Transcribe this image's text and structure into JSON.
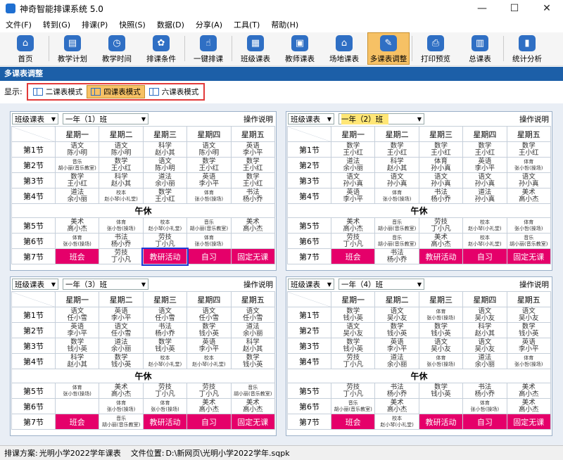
{
  "app": {
    "title": "神奇智能排课系统 5.0",
    "window_buttons": [
      "—",
      "☐",
      "✕"
    ]
  },
  "menu": [
    "文件(F)",
    "转到(G)",
    "排课(P)",
    "快照(S)",
    "数据(D)",
    "分享(A)",
    "工具(T)",
    "帮助(H)"
  ],
  "toolbar": [
    {
      "label": "首页",
      "icon": "home-icon",
      "glyph": "⌂"
    },
    {
      "label": "教学计划",
      "icon": "plan-icon",
      "glyph": "▤"
    },
    {
      "label": "教学时间",
      "icon": "clock-icon",
      "glyph": "◷"
    },
    {
      "label": "排课条件",
      "icon": "conditions-icon",
      "glyph": "✿"
    },
    {
      "label": "一键排课",
      "icon": "one-click-icon",
      "glyph": "☝"
    },
    {
      "label": "班级课表",
      "icon": "class-timetable-icon",
      "glyph": "▦"
    },
    {
      "label": "教师课表",
      "icon": "teacher-timetable-icon",
      "glyph": "▣"
    },
    {
      "label": "场地课表",
      "icon": "venue-timetable-icon",
      "glyph": "⌂"
    },
    {
      "label": "多课表调整",
      "icon": "multi-adjust-icon",
      "glyph": "✎",
      "active": true
    },
    {
      "label": "打印预览",
      "icon": "print-icon",
      "glyph": "⎙"
    },
    {
      "label": "总课表",
      "icon": "master-timetable-icon",
      "glyph": "▥"
    },
    {
      "label": "统计分析",
      "icon": "statistics-icon",
      "glyph": "▮"
    }
  ],
  "section_title": "多课表调整",
  "mode": {
    "label": "显示:",
    "options": [
      {
        "label": "二课表模式",
        "active": false
      },
      {
        "label": "四课表模式",
        "active": true
      },
      {
        "label": "六课表模式",
        "active": false
      }
    ]
  },
  "days": [
    "星期一",
    "星期二",
    "星期三",
    "星期四",
    "星期五"
  ],
  "periods": [
    "第1节",
    "第2节",
    "第3节",
    "第4节",
    "第5节",
    "第6节",
    "第7节"
  ],
  "lunch": "午休",
  "panels": [
    {
      "type": "班级课表",
      "class": "一年（1）班",
      "help": "操作说明",
      "highlight": false,
      "rows": [
        [
          [
            "语文",
            "陈小明"
          ],
          [
            "语文",
            "陈小明"
          ],
          [
            "科学",
            "赵小其"
          ],
          [
            "语文",
            "陈小明"
          ],
          [
            "英语",
            "李小平"
          ]
        ],
        [
          [
            "音乐",
            "胡小丽(音乐教室)"
          ],
          [
            "数学",
            "王小红"
          ],
          [
            "语文",
            "陈小明"
          ],
          [
            "数学",
            "王小红"
          ],
          [
            "数学",
            "王小红"
          ]
        ],
        [
          [
            "数学",
            "王小红"
          ],
          [
            "科学",
            "赵小其"
          ],
          [
            "道法",
            "余小丽"
          ],
          [
            "英语",
            "李小平"
          ],
          [
            "数学",
            "王小红"
          ]
        ],
        [
          [
            "道法",
            "余小丽"
          ],
          [
            "校本",
            "赵小琴(小礼堂)"
          ],
          [
            "数学",
            "王小红"
          ],
          [
            "体育",
            "张小哲(操场)"
          ],
          [
            "书法",
            "杨小乔"
          ]
        ],
        [
          [
            "美术",
            "高小杰"
          ],
          [
            "体育",
            "张小哲(操场)"
          ],
          [
            "校本",
            "赵小琴(小礼堂)"
          ],
          [
            "音乐",
            "胡小丽(音乐教室)"
          ],
          [
            "美术",
            "高小杰"
          ]
        ],
        [
          [
            "体育",
            "张小哲(操场)"
          ],
          [
            "书法",
            "杨小乔"
          ],
          [
            "劳技",
            "丁小凡"
          ],
          [
            "体育",
            "张小哲(操场)"
          ],
          [
            "",
            ""
          ]
        ],
        [
          [
            "班会"
          ],
          [
            "劳技",
            "丁小凡"
          ],
          [
            "教研活动"
          ],
          [
            "自习"
          ],
          [
            "固定无课"
          ]
        ]
      ]
    },
    {
      "type": "班级课表",
      "class": "一年（2）班",
      "help": "操作说明",
      "highlight": true,
      "rows": [
        [
          [
            "数学",
            "王小红"
          ],
          [
            "数学",
            "王小红"
          ],
          [
            "数学",
            "王小红"
          ],
          [
            "数学",
            "王小红"
          ],
          [
            "数学",
            "王小红"
          ]
        ],
        [
          [
            "道法",
            "余小丽"
          ],
          [
            "科学",
            "赵小其"
          ],
          [
            "体育",
            "孙小真"
          ],
          [
            "英语",
            "李小平"
          ],
          [
            "体育",
            "张小哲(操场)"
          ]
        ],
        [
          [
            "语文",
            "孙小真"
          ],
          [
            "语文",
            "孙小真"
          ],
          [
            "语文",
            "孙小真"
          ],
          [
            "语文",
            "孙小真"
          ],
          [
            "语文",
            "孙小真"
          ]
        ],
        [
          [
            "英语",
            "李小平"
          ],
          [
            "体育",
            "张小哲(操场)"
          ],
          [
            "书法",
            "杨小乔"
          ],
          [
            "道法",
            "孙小真"
          ],
          [
            "美术",
            "高小杰"
          ]
        ],
        [
          [
            "美术",
            "高小杰"
          ],
          [
            "音乐",
            "胡小丽(音乐教室)"
          ],
          [
            "劳技",
            "丁小凡"
          ],
          [
            "校本",
            "赵小琴(小礼堂)"
          ],
          [
            "体育",
            "张小哲(操场)"
          ]
        ],
        [
          [
            "劳技",
            "丁小凡"
          ],
          [
            "音乐",
            "胡小丽(音乐教室)"
          ],
          [
            "美术",
            "高小杰"
          ],
          [
            "校本",
            "赵小琴(小礼堂)"
          ],
          [
            "音乐",
            "胡小丽(音乐教室)"
          ]
        ],
        [
          [
            "班会"
          ],
          [
            "书法",
            "杨小乔"
          ],
          [
            "教研活动"
          ],
          [
            "自习"
          ],
          [
            "固定无课"
          ]
        ]
      ]
    },
    {
      "type": "班级课表",
      "class": "一年（3）班",
      "help": "操作说明",
      "highlight": false,
      "rows": [
        [
          [
            "语文",
            "任小雪"
          ],
          [
            "英语",
            "李小平"
          ],
          [
            "语文",
            "任小雪"
          ],
          [
            "语文",
            "任小雪"
          ],
          [
            "语文",
            "任小雪"
          ]
        ],
        [
          [
            "英语",
            "李小平"
          ],
          [
            "语文",
            "任小雪"
          ],
          [
            "书法",
            "杨小乔"
          ],
          [
            "数学",
            "钱小英"
          ],
          [
            "道法",
            "余小丽"
          ]
        ],
        [
          [
            "数学",
            "钱小英"
          ],
          [
            "道法",
            "余小丽"
          ],
          [
            "数学",
            "钱小英"
          ],
          [
            "英语",
            "李小平"
          ],
          [
            "科学",
            "赵小其"
          ]
        ],
        [
          [
            "科学",
            "赵小其"
          ],
          [
            "数学",
            "钱小英"
          ],
          [
            "校本",
            "赵小琴(小礼堂)"
          ],
          [
            "校本",
            "赵小琴(小礼堂)"
          ],
          [
            "数学",
            "钱小英"
          ]
        ],
        [
          [
            "体育",
            "张小哲(操场)"
          ],
          [
            "美术",
            "高小杰"
          ],
          [
            "劳技",
            "丁小凡"
          ],
          [
            "劳技",
            "丁小凡"
          ],
          [
            "音乐",
            "胡小丽(音乐教室)"
          ]
        ],
        [
          [
            "",
            ""
          ],
          [
            "体育",
            "张小哲(操场)"
          ],
          [
            "体育",
            "张小哲(操场)"
          ],
          [
            "美术",
            "高小杰"
          ],
          [
            "美术",
            "高小杰"
          ]
        ],
        [
          [
            "班会"
          ],
          [
            "音乐",
            "胡小丽(音乐教室)"
          ],
          [
            "教研活动"
          ],
          [
            "自习"
          ],
          [
            "固定无课"
          ]
        ]
      ]
    },
    {
      "type": "班级课表",
      "class": "一年（4）班",
      "help": "操作说明",
      "highlight": false,
      "rows": [
        [
          [
            "数学",
            "钱小英"
          ],
          [
            "语文",
            "吴小友"
          ],
          [
            "体育",
            "张小哲(操场)"
          ],
          [
            "语文",
            "吴小友"
          ],
          [
            "语文",
            "吴小友"
          ]
        ],
        [
          [
            "语文",
            "吴小友"
          ],
          [
            "数学",
            "钱小英"
          ],
          [
            "数学",
            "钱小英"
          ],
          [
            "科学",
            "赵小其"
          ],
          [
            "数学",
            "钱小英"
          ]
        ],
        [
          [
            "数学",
            "钱小英"
          ],
          [
            "英语",
            "李小平"
          ],
          [
            "语文",
            "吴小友"
          ],
          [
            "语文",
            "吴小友"
          ],
          [
            "英语",
            "李小平"
          ]
        ],
        [
          [
            "劳技",
            "丁小凡"
          ],
          [
            "道法",
            "余小丽"
          ],
          [
            "体育",
            "张小哲(操场)"
          ],
          [
            "道法",
            "余小丽"
          ],
          [
            "体育",
            "张小哲(操场)"
          ]
        ],
        [
          [
            "劳技",
            "丁小凡"
          ],
          [
            "书法",
            "杨小乔"
          ],
          [
            "数学",
            "钱小英"
          ],
          [
            "书法",
            "杨小乔"
          ],
          [
            "美术",
            "高小杰"
          ]
        ],
        [
          [
            "音乐",
            "胡小丽(音乐教室)"
          ],
          [
            "美术",
            "高小杰"
          ],
          [
            "",
            ""
          ],
          [
            "体育",
            "张小哲(操场)"
          ],
          [
            "美术",
            "高小杰"
          ]
        ],
        [
          [
            "班会"
          ],
          [
            "校本",
            "赵小琴(小礼堂)"
          ],
          [
            "教研活动"
          ],
          [
            "自习"
          ],
          [
            "固定无课"
          ]
        ]
      ]
    }
  ],
  "status": {
    "plan_label": "排课方案:",
    "plan_value": "光明小学2022学年课表",
    "file_label": "文件位置:",
    "file_value": "D:\\新网页\\光明小学2022学年.sqpk"
  }
}
